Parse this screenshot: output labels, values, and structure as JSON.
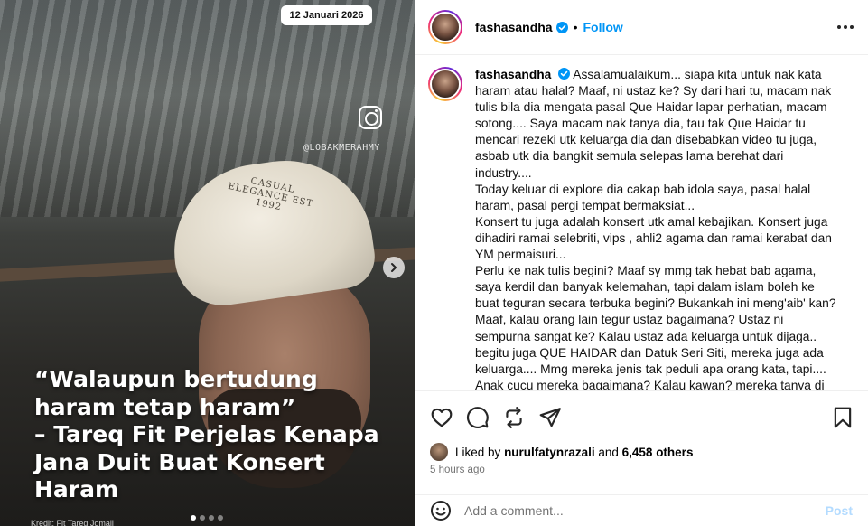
{
  "media": {
    "date_chip": "12 Januari 2026",
    "watermark": "@LOBAKMERAHMY",
    "cap_text": "CASUAL ELEGANCE EST 1992",
    "headline_quote": "“Walaupun bertudung haram tetap haram”",
    "headline_sub": "– Tareq Fit Perjelas Kenapa Jana Duit Buat Konsert Haram",
    "credit": "Kredit: Fit Tareq Jomali",
    "carousel_dots": 4,
    "carousel_active": 0
  },
  "post": {
    "username": "fashasandha",
    "follow_label": "Follow",
    "separator": "•",
    "caption": "Assalamualaikum... siapa kita untuk nak kata haram atau halal? Maaf, ni ustaz ke? Sy dari hari tu, macam nak tulis bila dia mengata pasal Que Haidar lapar perhatian, macam sotong.... Saya macam nak tanya dia, tau tak Que Haidar tu mencari rezeki utk keluarga dia dan disebabkan video tu juga, asbab utk dia bangkit semula selepas lama berehat dari industry....\nToday keluar di explore dia cakap bab idola saya, pasal halal haram, pasal pergi tempat bermaksiat...\nKonsert tu juga adalah konsert utk amal kebajikan. Konsert juga dihadiri ramai selebriti, vips , ahli2 agama dan ramai kerabat dan YM permaisuri...\nPerlu ke nak tulis begini? Maaf sy mmg tak hebat bab agama, saya kerdil dan banyak kelemahan, tapi dalam islam boleh ke buat teguran secara terbuka begini? Bukankah ini meng'aib' kan? Maaf, kalau orang lain tegur ustaz bagaimana? Ustaz ni sempurna sangat ke? Kalau ustaz ada keluarga untuk dijaga.. begitu juga QUE HAIDAR dan Datuk Seri Siti, mereka juga ada keluarga.... Mmg mereka jenis tak peduli apa orang kata, tapi.... Anak cucu mereka bagaimana? Kalau kawan? mereka tanya di",
    "likes_prefix": "Liked by",
    "liked_by_user": "nurulfatynrazali",
    "likes_and": "and",
    "likes_others": "6,458 others",
    "time_ago": "5 hours ago",
    "comment_placeholder": "Add a comment...",
    "post_label": "Post"
  },
  "colors": {
    "accent_blue": "#0095f6",
    "post_disabled": "#b3dbff",
    "muted_text": "#737373",
    "divider": "#efefef"
  },
  "icons": [
    "instagram-icon",
    "chevron-right-icon",
    "verified-badge-icon",
    "more-options-icon",
    "heart-icon",
    "comment-icon",
    "repost-icon",
    "share-icon",
    "bookmark-icon",
    "emoji-icon"
  ]
}
